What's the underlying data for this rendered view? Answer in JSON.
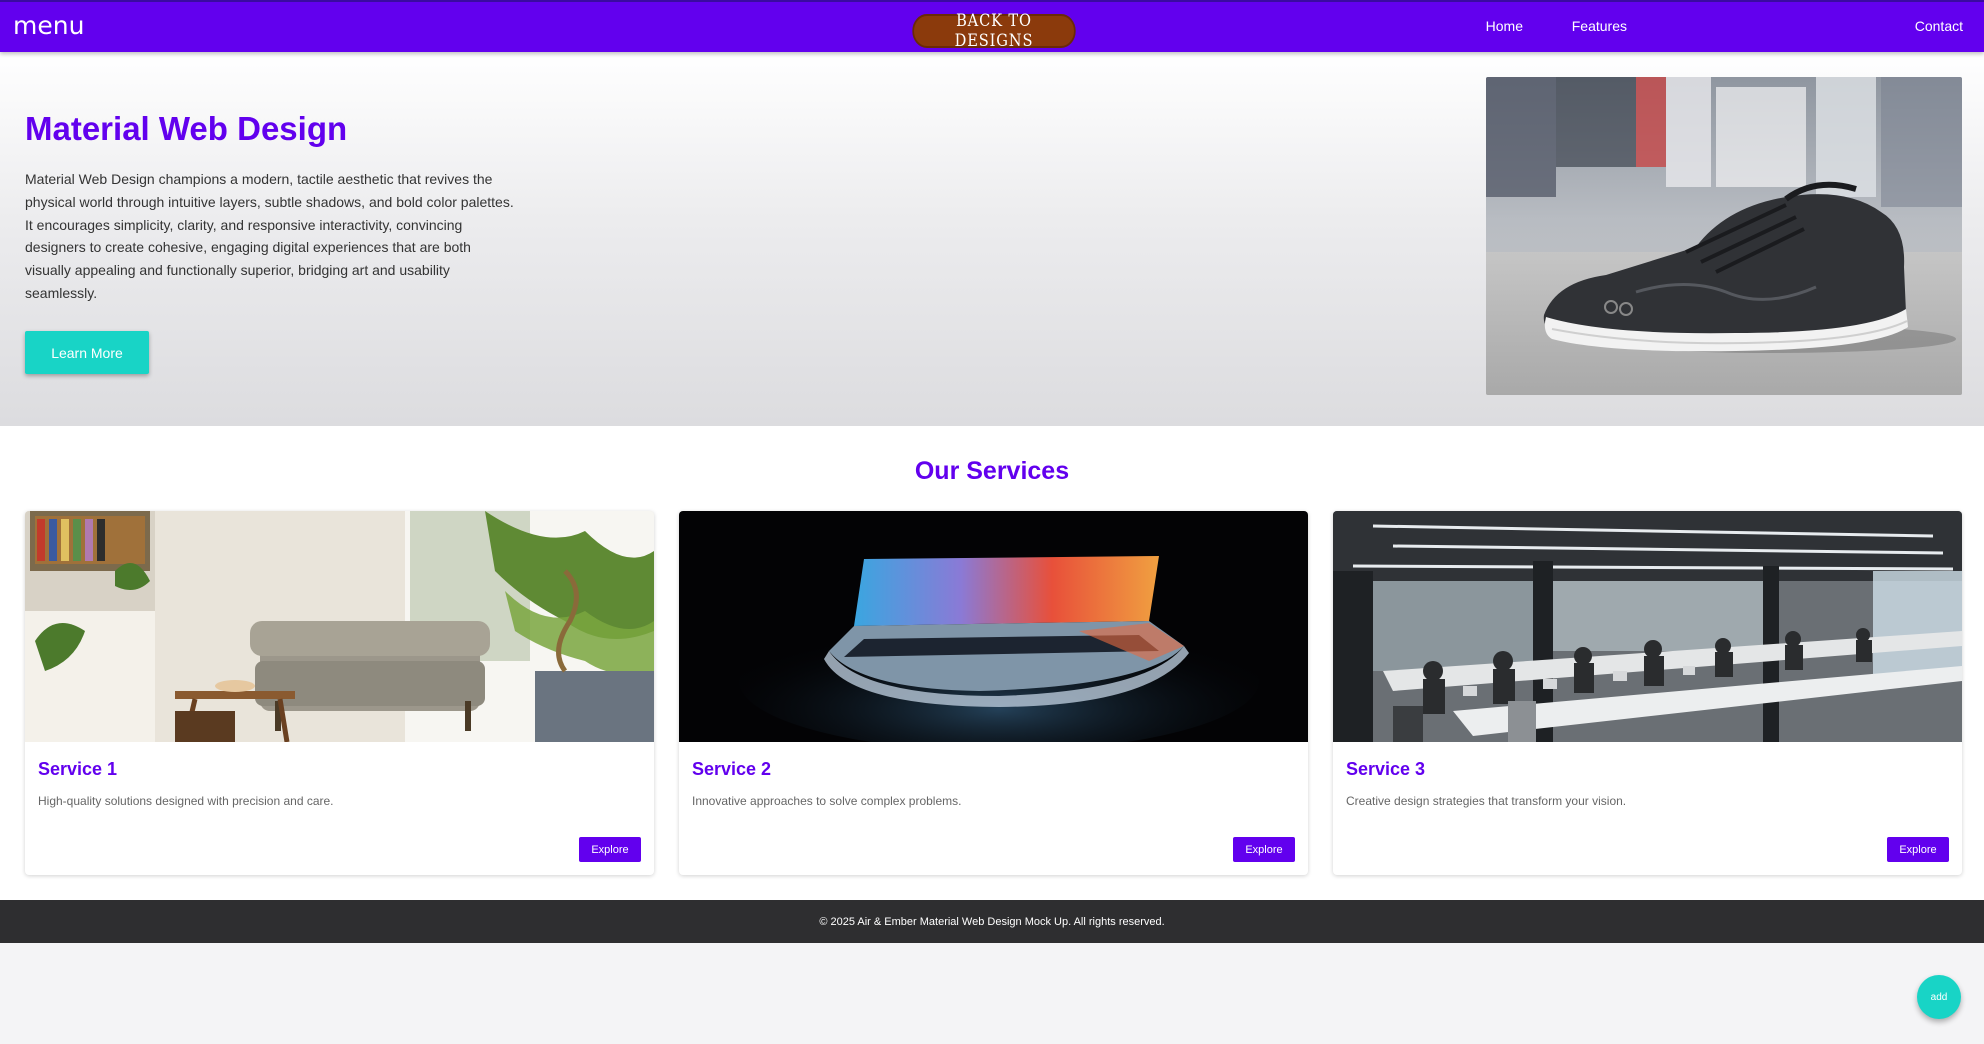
{
  "colors": {
    "primary": "#6200ee",
    "accent": "#18d4c6",
    "back_button": "#8b3a0c",
    "footer": "#2e2e30"
  },
  "appbar": {
    "menu_label": "menu",
    "back_label": "BACK TO DESIGNS",
    "nav": {
      "home": "Home",
      "features": "Features",
      "contact": "Contact"
    }
  },
  "hero": {
    "title": "Material Web Design",
    "description": "Material Web Design champions a modern, tactile aesthetic that revives the physical world through intuitive layers, subtle shadows, and bold color palettes. It encourages simplicity, clarity, and responsive interactivity, convincing designers to create cohesive, engaging digital experiences that are both visually appealing and functionally superior, bridging art and usability seamlessly.",
    "button_label": "Learn More",
    "image_icon": "sneaker-photo"
  },
  "services": {
    "title": "Our Services",
    "cards": [
      {
        "title": "Service 1",
        "description": "High-quality solutions designed with precision and care.",
        "button_label": "Explore",
        "image_icon": "living-room-photo"
      },
      {
        "title": "Service 2",
        "description": "Innovative approaches to solve complex problems.",
        "button_label": "Explore",
        "image_icon": "laptop-photo"
      },
      {
        "title": "Service 3",
        "description": "Creative design strategies that transform your vision.",
        "button_label": "Explore",
        "image_icon": "office-photo"
      }
    ]
  },
  "footer": {
    "text": "© 2025 Air & Ember Material Web Design Mock Up. All rights reserved."
  },
  "fab": {
    "label": "add"
  }
}
